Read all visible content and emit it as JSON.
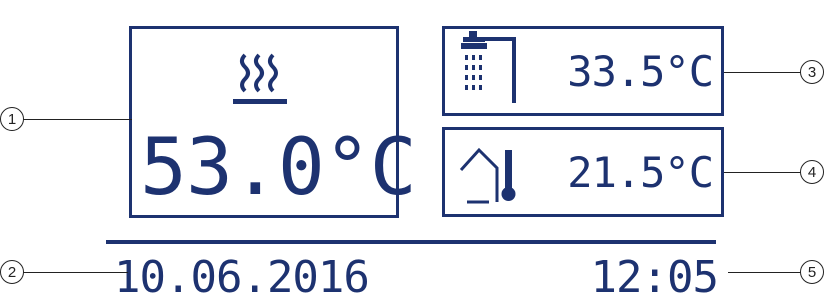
{
  "display": {
    "heating": {
      "icon": "heating-flow-icon",
      "temperature": "53.0°C"
    },
    "hot_water": {
      "icon": "shower-icon",
      "temperature": "33.5°C"
    },
    "outdoor": {
      "icon": "house-thermometer-icon",
      "temperature": "21.5°C"
    },
    "date": "10.06.2016",
    "time": "12:05"
  },
  "callouts": [
    "1",
    "2",
    "3",
    "4",
    "5"
  ],
  "colors": {
    "lcd_text": "#1d3270",
    "lcd_background": "#c5d4e5",
    "callout": "#222222"
  }
}
